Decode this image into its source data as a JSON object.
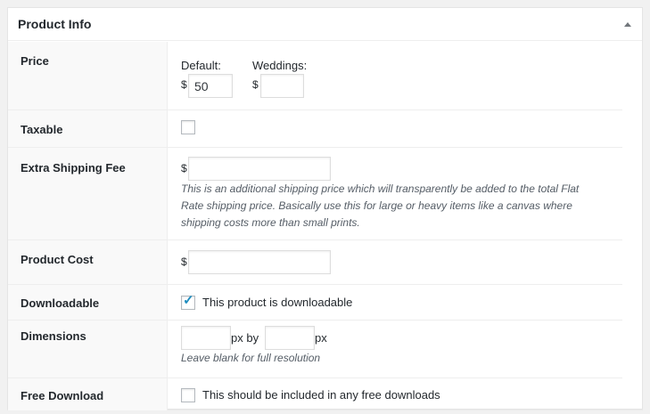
{
  "panel": {
    "title": "Product Info"
  },
  "rows": {
    "price": {
      "label": "Price",
      "default_label": "Default:",
      "default_currency": "$",
      "default_value": "50",
      "weddings_label": "Weddings:",
      "weddings_currency": "$",
      "weddings_value": ""
    },
    "taxable": {
      "label": "Taxable",
      "checked": false
    },
    "shipping": {
      "label": "Extra Shipping Fee",
      "currency": "$",
      "value": "",
      "description": "This is an additional shipping price which will transparently be added to the total Flat Rate shipping price. Basically use this for large or heavy items like a canvas where shipping costs more than small prints."
    },
    "cost": {
      "label": "Product Cost",
      "currency": "$",
      "value": ""
    },
    "downloadable": {
      "label": "Downloadable",
      "checked": true,
      "checkbox_label": "This product is downloadable"
    },
    "dimensions": {
      "label": "Dimensions",
      "width_value": "",
      "unit1": "px by",
      "height_value": "",
      "unit2": "px",
      "description": "Leave blank for full resolution"
    },
    "free_download": {
      "label": "Free Download",
      "checked": false,
      "checkbox_label": "This should be included in any free downloads"
    }
  },
  "colors": {
    "accent": "#1e8cbe",
    "header_bg": "#f9f9f9",
    "border": "#eeeeee"
  }
}
